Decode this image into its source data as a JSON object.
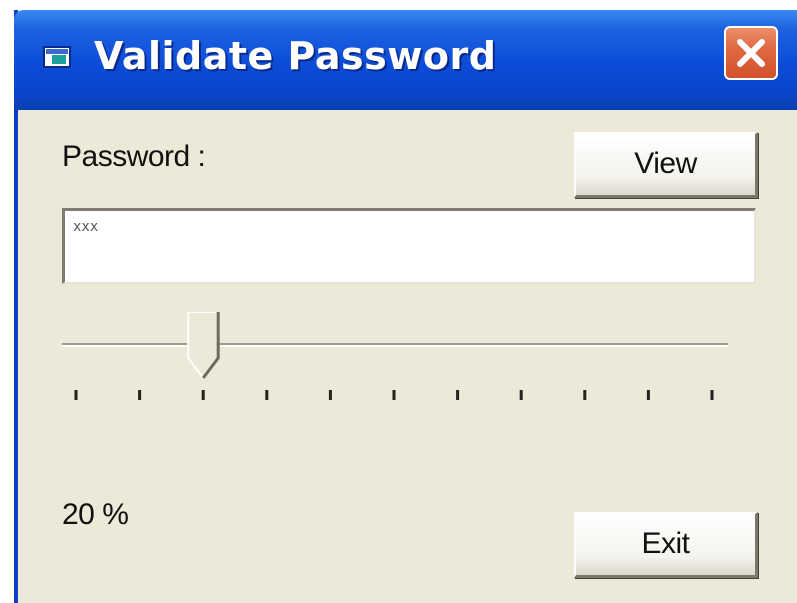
{
  "window": {
    "title": "Validate Password"
  },
  "form": {
    "password_label": "Password :",
    "password_value": "xxx",
    "view_button_label": "View",
    "exit_button_label": "Exit",
    "strength_text": "20 %"
  },
  "slider": {
    "value_percent": 20,
    "min": 0,
    "max": 100,
    "tick_count": 11
  },
  "colors": {
    "titlebar": "#0b4cd8",
    "close_button": "#e06a43",
    "window_background": "#ece9d8"
  },
  "icons": {
    "app": "window-app-icon",
    "close": "close-icon"
  }
}
